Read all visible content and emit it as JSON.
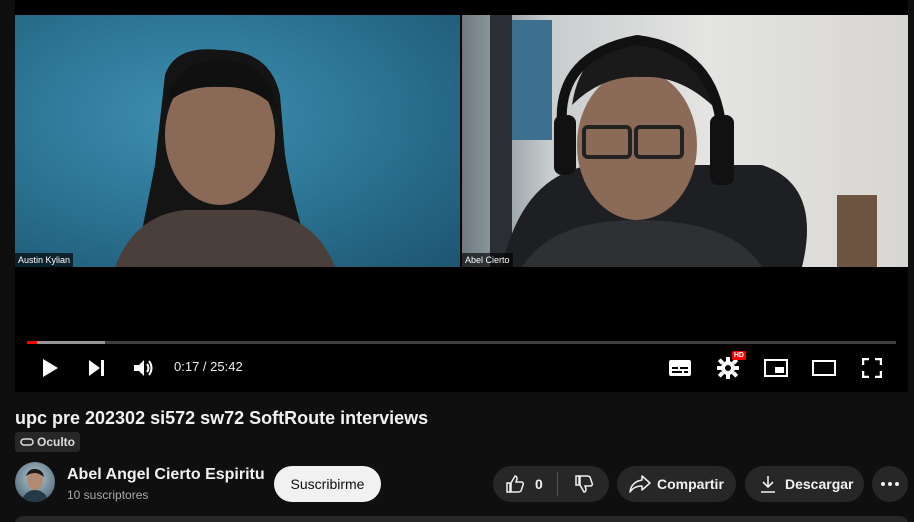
{
  "player": {
    "participants": [
      {
        "name": "Austin Kylian"
      },
      {
        "name": "Abel Cierto"
      }
    ],
    "time_display": "0:17 / 25:42",
    "progress_played_fraction": 0.011,
    "progress_buffered_fraction": 0.09,
    "hd_badge": "HD",
    "icons": [
      "play-icon",
      "next-icon",
      "volume-icon",
      "subtitles-icon",
      "settings-icon",
      "miniplayer-icon",
      "theater-icon",
      "fullscreen-icon"
    ]
  },
  "video": {
    "title": "upc pre 202302 si572 sw72 SoftRoute interviews",
    "privacy": "Oculto"
  },
  "channel": {
    "name": "Abel Angel Cierto Espiritu",
    "subscribers": "10 suscriptores",
    "subscribe_label": "Suscribirme"
  },
  "actions": {
    "like_count": "0",
    "share_label": "Compartir",
    "download_label": "Descargar"
  },
  "colors": {
    "accent": "#ff0000",
    "background": "#0f0f0f",
    "pill": "#272727"
  }
}
